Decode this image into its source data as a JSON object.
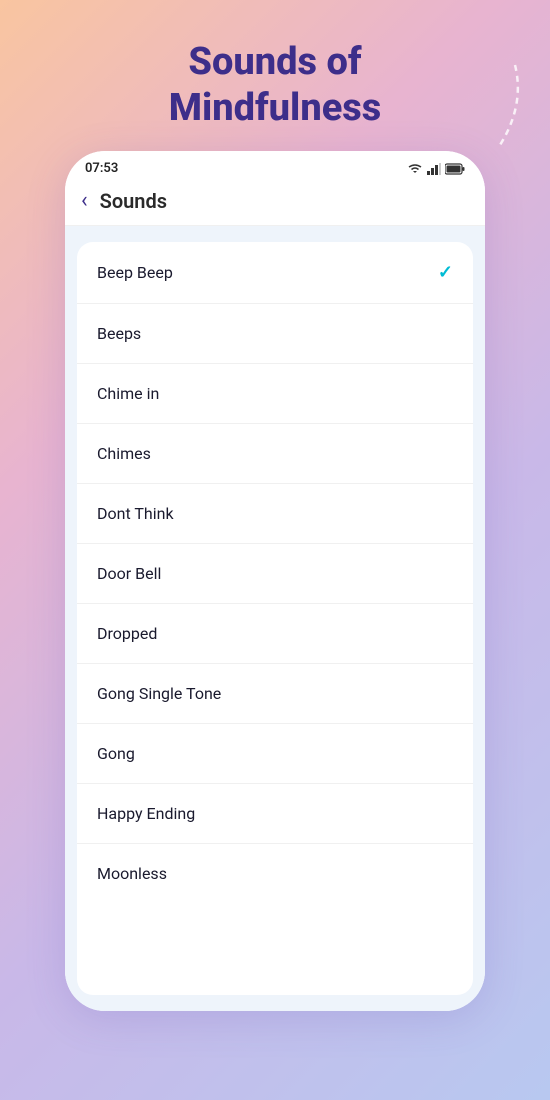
{
  "page": {
    "title_line1": "Sounds of",
    "title_line2": "Mindfulness"
  },
  "status_bar": {
    "time": "07:53"
  },
  "nav": {
    "back_label": "‹",
    "title": "Sounds"
  },
  "sounds": {
    "items": [
      {
        "id": "beep-beep",
        "label": "Beep Beep",
        "selected": true
      },
      {
        "id": "beeps",
        "label": "Beeps",
        "selected": false
      },
      {
        "id": "chime-in",
        "label": "Chime in",
        "selected": false
      },
      {
        "id": "chimes",
        "label": "Chimes",
        "selected": false
      },
      {
        "id": "dont-think",
        "label": "Dont Think",
        "selected": false
      },
      {
        "id": "door-bell",
        "label": "Door Bell",
        "selected": false
      },
      {
        "id": "dropped",
        "label": "Dropped",
        "selected": false
      },
      {
        "id": "gong-single-tone",
        "label": "Gong Single Tone",
        "selected": false
      },
      {
        "id": "gong",
        "label": "Gong",
        "selected": false
      },
      {
        "id": "happy-ending",
        "label": "Happy Ending",
        "selected": false
      },
      {
        "id": "moonless",
        "label": "Moonless",
        "selected": false
      }
    ],
    "check_symbol": "✓"
  },
  "colors": {
    "title": "#3d2e8a",
    "check": "#00bcd4",
    "text_dark": "#1a1a2e"
  }
}
